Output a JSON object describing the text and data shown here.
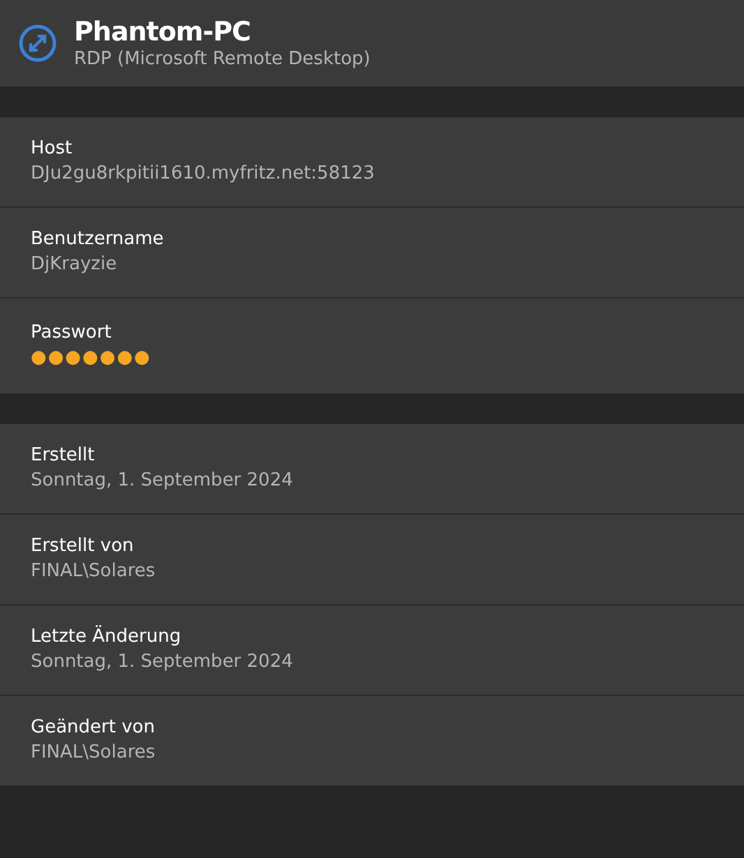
{
  "header": {
    "title": "Phantom-PC",
    "subtitle": "RDP (Microsoft Remote Desktop)"
  },
  "sections": [
    {
      "fields": [
        {
          "label": "Host",
          "value": "DJu2gu8rkpitii1610.myfritz.net:58123",
          "kind": "text"
        },
        {
          "label": "Benutzername",
          "value": "DjKrayzie",
          "kind": "text"
        },
        {
          "label": "Passwort",
          "value": "●●●●●●●",
          "kind": "secret"
        }
      ]
    },
    {
      "fields": [
        {
          "label": "Erstellt",
          "value": "Sonntag, 1. September 2024",
          "kind": "text"
        },
        {
          "label": "Erstellt von",
          "value": "FINAL\\Solares",
          "kind": "text"
        },
        {
          "label": "Letzte Änderung",
          "value": "Sonntag, 1. September 2024",
          "kind": "text"
        },
        {
          "label": "Geändert von",
          "value": "FINAL\\Solares",
          "kind": "text"
        }
      ]
    }
  ]
}
